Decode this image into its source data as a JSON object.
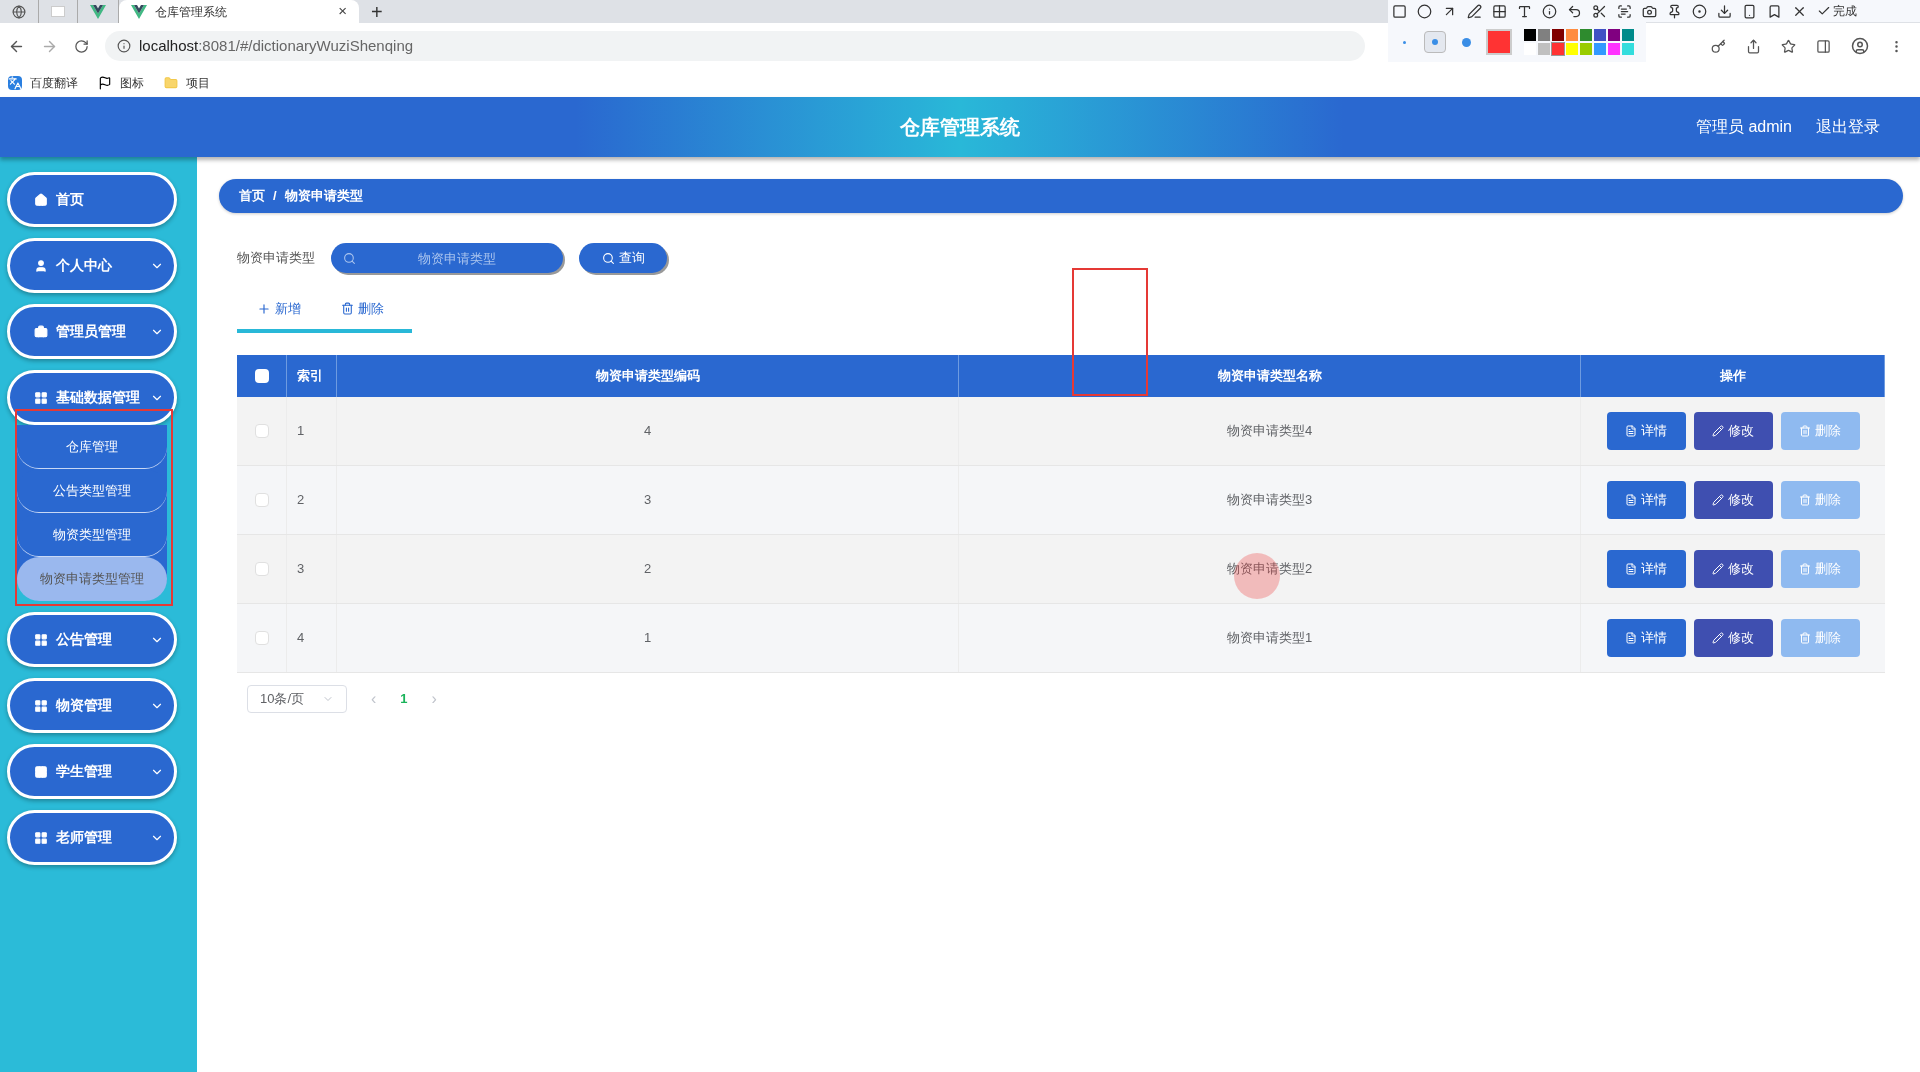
{
  "browser": {
    "tabs": [
      {
        "kind": "globe",
        "selected": false
      },
      {
        "kind": "blank",
        "selected": false
      },
      {
        "kind": "vue",
        "selected": false
      },
      {
        "kind": "vue",
        "title": "仓库管理系统",
        "selected": true
      }
    ],
    "close_tab": "×",
    "new_tab": "+",
    "url_host": "localhost",
    "url_rest": ":8081/#/dictionaryWuziShenqing",
    "bookmarks": [
      {
        "kind": "translate",
        "label": "百度翻译"
      },
      {
        "kind": "flag",
        "label": "图标"
      },
      {
        "kind": "folder",
        "label": "项目"
      }
    ]
  },
  "annotation_toolbar": {
    "done": "完成",
    "sizes": [
      {
        "selected": false
      },
      {
        "selected": true
      },
      {
        "selected": false
      }
    ],
    "palette": [
      {
        "color": "#000000",
        "selected": false
      },
      {
        "color": "#808080",
        "selected": false
      },
      {
        "color": "#800000",
        "selected": false
      },
      {
        "color": "#ff8c40",
        "selected": false
      },
      {
        "color": "#2e8b2e",
        "selected": false
      },
      {
        "color": "#3f51c5",
        "selected": false
      },
      {
        "color": "#800080",
        "selected": false
      },
      {
        "color": "#008b8b",
        "selected": false
      },
      {
        "color": "#ffffff",
        "selected": false
      },
      {
        "color": "#c0c0c0",
        "selected": false
      },
      {
        "color": "#ff3333",
        "selected": true
      },
      {
        "color": "#ffff00",
        "selected": false
      },
      {
        "color": "#99cc00",
        "selected": false
      },
      {
        "color": "#3399ff",
        "selected": false
      },
      {
        "color": "#ff33ff",
        "selected": false
      },
      {
        "color": "#33dddd",
        "selected": false
      }
    ]
  },
  "header": {
    "title": "仓库管理系统",
    "user": "管理员 admin",
    "logout": "退出登录"
  },
  "sidebar": {
    "items": [
      {
        "label": "首页"
      },
      {
        "label": "个人中心",
        "expandable": true
      },
      {
        "label": "管理员管理",
        "expandable": true
      },
      {
        "label": "基础数据管理",
        "expandable": true,
        "children": [
          {
            "label": "仓库管理",
            "selected": false
          },
          {
            "label": "公告类型管理",
            "selected": false
          },
          {
            "label": "物资类型管理",
            "selected": false
          },
          {
            "label": "物资申请类型管理",
            "selected": true
          }
        ]
      },
      {
        "label": "公告管理",
        "expandable": true
      },
      {
        "label": "物资管理",
        "expandable": true
      },
      {
        "label": "学生管理",
        "expandable": true
      },
      {
        "label": "老师管理",
        "expandable": true
      }
    ]
  },
  "breadcrumb": [
    "首页",
    "/",
    "物资申请类型"
  ],
  "search": {
    "label": "物资申请类型",
    "placeholder": "物资申请类型",
    "button": "查询"
  },
  "actions": [
    {
      "kind": "add",
      "label": "新增"
    },
    {
      "kind": "delete",
      "label": "删除"
    }
  ],
  "table": {
    "select_all_checked": false,
    "columns": [
      "索引",
      "物资申请类型编码",
      "物资申请类型名称",
      "操作"
    ],
    "rows": [
      {
        "checked": false,
        "cells": [
          "1",
          "4",
          "物资申请类型4"
        ],
        "actions": [
          {
            "kind": "detail",
            "label": "详情"
          },
          {
            "kind": "edit",
            "label": "修改"
          },
          {
            "kind": "delete",
            "label": "删除"
          }
        ]
      },
      {
        "checked": false,
        "cells": [
          "2",
          "3",
          "物资申请类型3"
        ],
        "actions": [
          {
            "kind": "detail",
            "label": "详情"
          },
          {
            "kind": "edit",
            "label": "修改"
          },
          {
            "kind": "delete",
            "label": "删除"
          }
        ]
      },
      {
        "checked": false,
        "cells": [
          "3",
          "2",
          "物资申请类型2"
        ],
        "actions": [
          {
            "kind": "detail",
            "label": "详情"
          },
          {
            "kind": "edit",
            "label": "修改"
          },
          {
            "kind": "delete",
            "label": "删除"
          }
        ]
      },
      {
        "checked": false,
        "cells": [
          "4",
          "1",
          "物资申请类型1"
        ],
        "actions": [
          {
            "kind": "detail",
            "label": "详情"
          },
          {
            "kind": "edit",
            "label": "修改"
          },
          {
            "kind": "delete",
            "label": "删除"
          }
        ]
      }
    ]
  },
  "pagination": {
    "page_size": "10条/页",
    "prev": "‹",
    "pages": [
      {
        "label": "1",
        "selected": true
      }
    ],
    "next": "›"
  }
}
